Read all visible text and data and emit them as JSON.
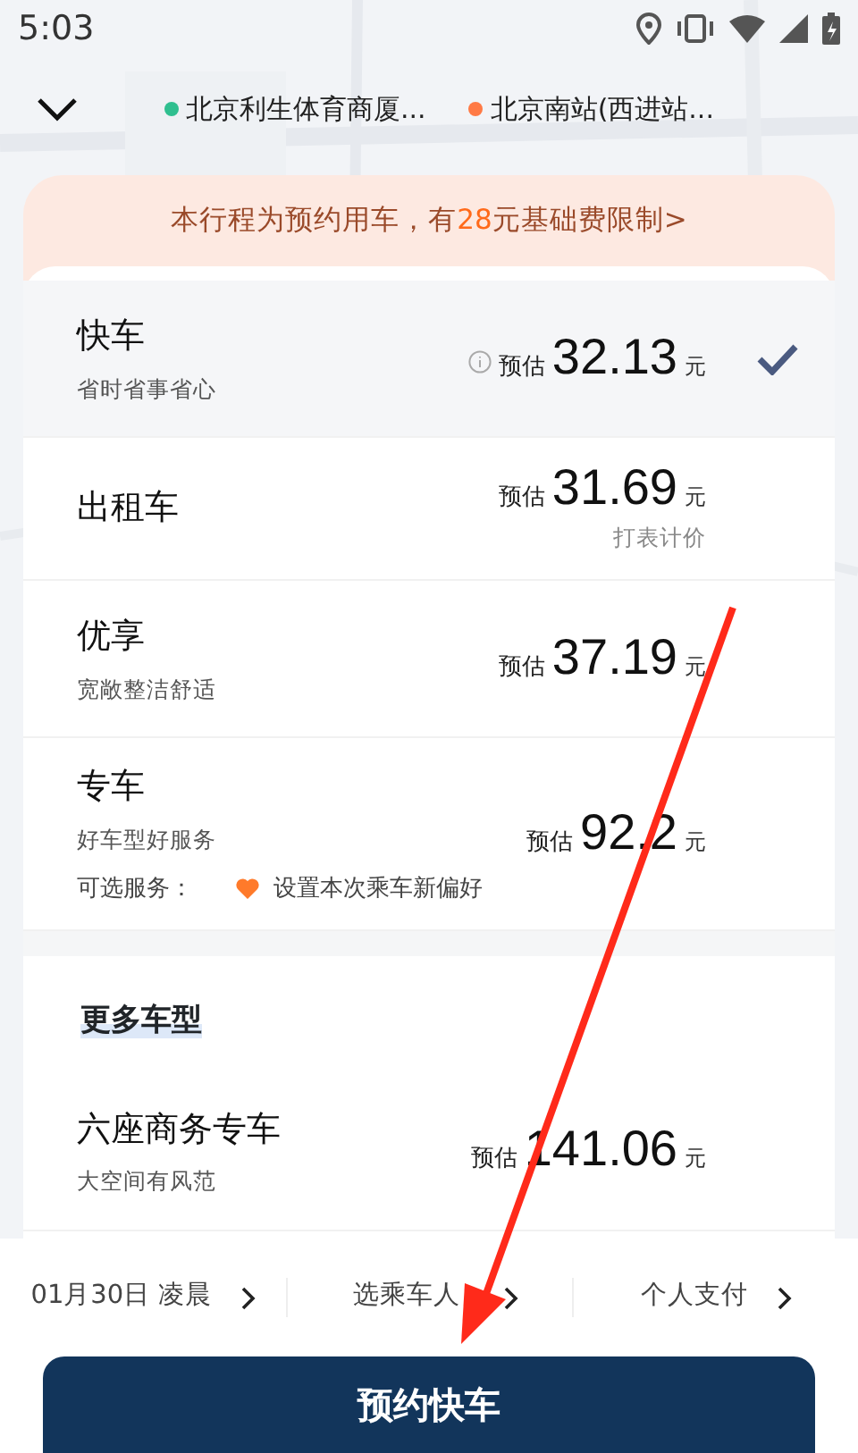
{
  "status_bar": {
    "time": "5:03"
  },
  "route": {
    "origin": {
      "text": "北京利生体育商厦...",
      "color": "#2fbf8f"
    },
    "destination": {
      "text": "北京南站(西进站...",
      "color": "#ff7a45"
    }
  },
  "notice": {
    "before": "本行程为预约用车，有",
    "highlight": "28",
    "after": "元基础费限制>"
  },
  "cars": [
    {
      "name": "快车",
      "subtitle": "省时省事省心",
      "info": true,
      "est_label": "预估",
      "price": "32.13",
      "unit": "元",
      "selected": true
    },
    {
      "name": "出租车",
      "est_label": "预估",
      "price": "31.69",
      "unit": "元",
      "note": "打表计价",
      "selected": false
    },
    {
      "name": "优享",
      "subtitle": "宽敞整洁舒适",
      "est_label": "预估",
      "price": "37.19",
      "unit": "元",
      "selected": false
    },
    {
      "name": "专车",
      "subtitle": "好车型好服务",
      "est_label": "预估",
      "price": "92.2",
      "unit": "元",
      "service": {
        "label": "可选服务：",
        "text": "设置本次乘车新偏好"
      },
      "selected": false
    }
  ],
  "more": {
    "title": "更多车型",
    "cars": [
      {
        "name": "六座商务专车",
        "subtitle": "大空间有风范",
        "est_label": "预估",
        "price": "141.06",
        "unit": "元",
        "selected": false
      }
    ]
  },
  "options": [
    {
      "parts": [
        "01月30日",
        "凌晨"
      ]
    },
    {
      "parts": [
        "选乘车人"
      ]
    },
    {
      "parts": [
        "个人支付"
      ]
    }
  ],
  "button": "预约快车"
}
